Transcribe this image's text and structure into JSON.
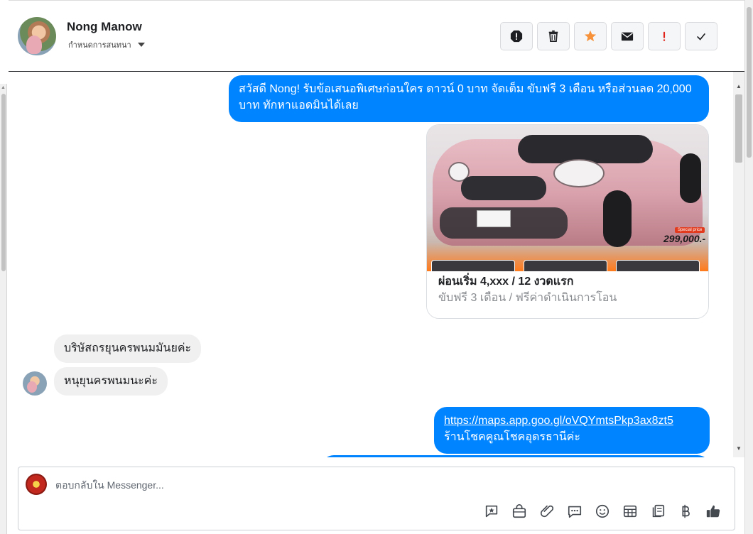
{
  "header": {
    "contact_name": "Nong Manow",
    "assign_label": "กำหนดการสนทนา"
  },
  "actions": [
    {
      "name": "report-icon",
      "color": "#1c1e21"
    },
    {
      "name": "trash-icon",
      "color": "#1c1e21"
    },
    {
      "name": "star-icon",
      "color": "#f7923a"
    },
    {
      "name": "envelope-icon",
      "color": "#1c1e21"
    },
    {
      "name": "exclamation-icon",
      "color": "#e0241b"
    },
    {
      "name": "check-icon",
      "color": "#1c1e21"
    }
  ],
  "messages": {
    "outgoing_1": "สวัสดี Nong! รับข้อเสนอพิเศษก่อนใคร ดาวน์ 0 บาท จัดเต็ม ขับฟรี 3 เดือน หรือส่วนลด 20,000 บาท ทักหาแอดมินได้เลย",
    "card": {
      "special_badge": "Special price",
      "price": "299,000.-",
      "title": "ผ่อนเริ่ม 4,xxx / 12 งวดแรก",
      "subtitle": "ขับฟรี 3 เดือน / ฟรีค่าดำเนินการโอน"
    },
    "incoming_1": "บริษัสถรยุนครพนมมันยค่ะ",
    "incoming_2": "หนุยุนครพนมนะค่ะ",
    "outgoing_2_link": "https://maps.app.goo.gl/oVQYmtsPkp3ax8zt5",
    "outgoing_2_text": "ร้านโชคคูณโชคอุดรธานีค่ะ"
  },
  "composer": {
    "placeholder": "ตอบกลับใน Messenger...",
    "tools": [
      "saved-reply-icon",
      "shop-icon",
      "attachment-icon",
      "quick-reply-icon",
      "emoji-icon",
      "table-icon",
      "catalog-icon",
      "baht-icon",
      "like-icon"
    ]
  },
  "colors": {
    "outgoing_bubble": "#0084ff",
    "incoming_bubble": "#f0f0f0"
  }
}
